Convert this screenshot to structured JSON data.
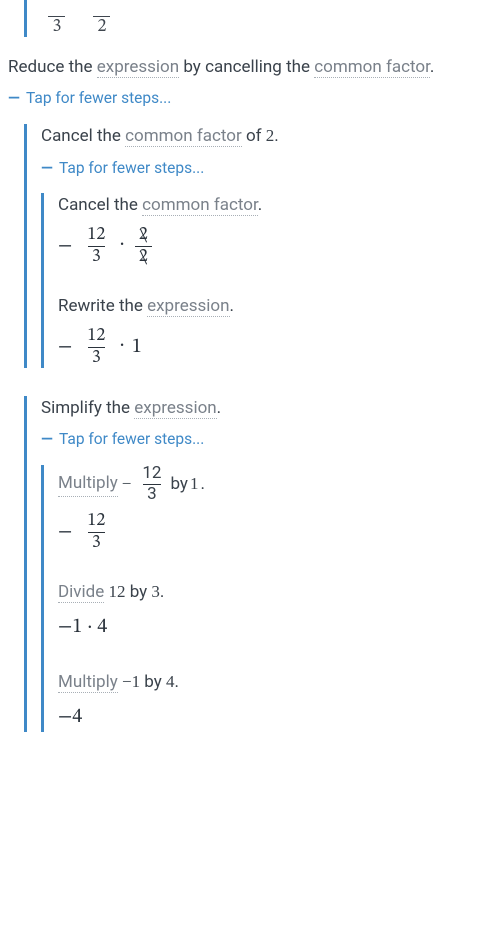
{
  "terms": {
    "expression": "expression",
    "common_factor": "common factor",
    "multiply": "Multiply",
    "divide": "Divide"
  },
  "toggle_label": "Tap for fewer steps...",
  "top_frac": {
    "a_den": "3",
    "b_den": "2"
  },
  "s1": {
    "text_pre": "Reduce the ",
    "text_mid": " by cancelling the ",
    "text_post": "."
  },
  "s2": {
    "text_pre": "Cancel the ",
    "text_post": " of ",
    "value": "2",
    "period": "."
  },
  "s3": {
    "text_pre": "Cancel the ",
    "text_post": "."
  },
  "m1": {
    "neg": "−",
    "num": "12",
    "den": "3",
    "c_num": "2",
    "c_den": "2"
  },
  "s4": {
    "text_pre": "Rewrite the ",
    "text_post": "."
  },
  "m2": {
    "neg": "−",
    "num": "12",
    "den": "3",
    "times": "1"
  },
  "s5": {
    "text_pre": "Simplify the ",
    "text_post": "."
  },
  "s6": {
    "mid1": " ",
    "neg": "−",
    "num": "12",
    "den": "3",
    "mid2": " by ",
    "val": "1",
    "period": "."
  },
  "m3": {
    "neg": "−",
    "num": "12",
    "den": "3"
  },
  "s7": {
    "mid1": " ",
    "a": "12",
    "mid2": " by ",
    "b": "3",
    "period": "."
  },
  "m4": {
    "text": "−1 · 4"
  },
  "s8": {
    "mid1": " ",
    "a": "−1",
    "mid2": " by ",
    "b": "4",
    "period": "."
  },
  "m5": {
    "text": "−4"
  }
}
